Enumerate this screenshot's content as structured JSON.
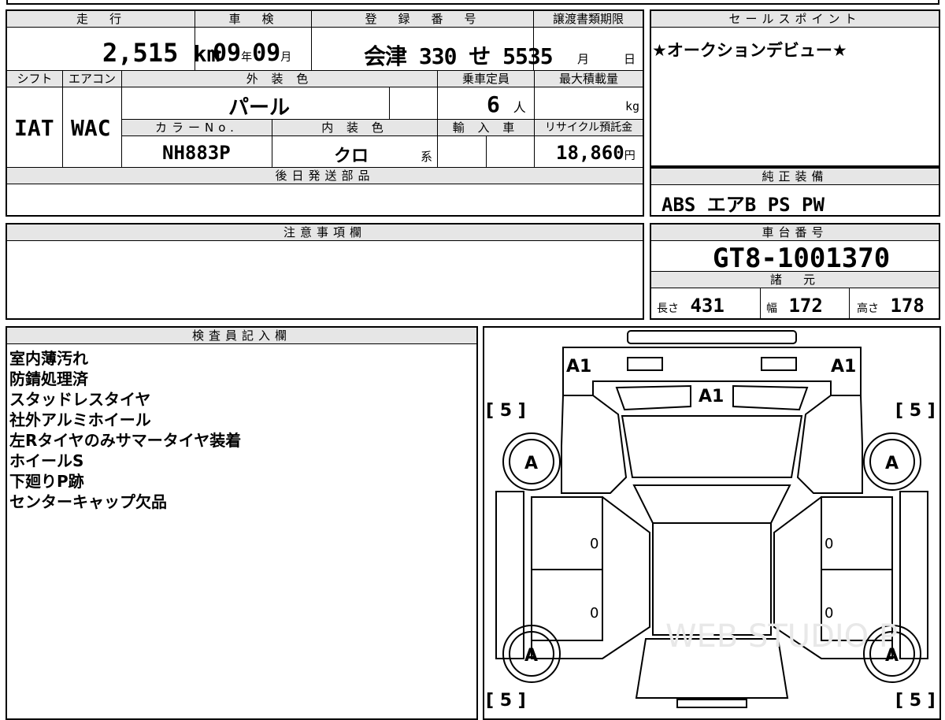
{
  "mileage": {
    "label": "走　行",
    "value": "2,515",
    "unit": "km"
  },
  "inspection": {
    "label": "車　検",
    "year": "09",
    "year_unit": "年",
    "month": "09",
    "month_unit": "月"
  },
  "registration": {
    "label": "登　録　番　号",
    "value": "会津 330 せ 5535"
  },
  "transfer_deadline": {
    "label": "譲渡書類期限",
    "month_unit": "月",
    "day_unit": "日"
  },
  "sales_point": {
    "label": "セールスポイント",
    "text": "★オークションデビュー★"
  },
  "shift": {
    "label": "シフト",
    "value": "IAT"
  },
  "aircon": {
    "label": "エアコン",
    "value": "WAC"
  },
  "exterior_color": {
    "label": "外 装 色",
    "value": "パール"
  },
  "capacity": {
    "label": "乗車定員",
    "value": "6",
    "unit": "人"
  },
  "max_load": {
    "label": "最大積載量",
    "unit": "kg"
  },
  "color_no": {
    "label": "カラーNo.",
    "value": "NH883P"
  },
  "interior_color": {
    "label": "内 装 色",
    "value": "クロ",
    "unit": "系"
  },
  "import": {
    "label": "輸 入 車"
  },
  "recycle": {
    "label": "リサイクル預託金",
    "value": "18,860",
    "unit": "円"
  },
  "later_parts": {
    "label": "後日発送部品"
  },
  "genuine_equipment": {
    "label": "純正装備",
    "value": "ABS  エアB  PS  PW"
  },
  "caution": {
    "label": "注意事項欄"
  },
  "chassis_no": {
    "label": "車台番号",
    "value": "GT8-1001370"
  },
  "specs": {
    "label": "諸　元",
    "length_label": "長さ",
    "length": "431",
    "width_label": "幅",
    "width": "172",
    "height_label": "高さ",
    "height": "178"
  },
  "inspector": {
    "label": "検査員記入欄",
    "notes": [
      "室内薄汚れ",
      "防錆処理済",
      "スタッドレスタイヤ",
      "社外アルミホイール",
      "左Rタイヤのみサマータイヤ装着",
      "ホイールS",
      "下廻りP跡",
      "センターキャップ欠品"
    ]
  },
  "diagram": {
    "a1_left": "A1",
    "a1_right": "A1",
    "a1_center": "A1",
    "tire_fl": "A",
    "tire_fr": "A",
    "tire_rl": "A",
    "tire_rr": "A",
    "tread_fl": "[ 5 ]",
    "tread_fr": "[ 5 ]",
    "tread_rl": "[ 5 ]",
    "tread_rr": "[ 5 ]",
    "door_lf": "0",
    "door_rf": "0",
    "door_lr": "0",
    "door_rr": "0",
    "watermark": "WEB STUDIO P"
  }
}
